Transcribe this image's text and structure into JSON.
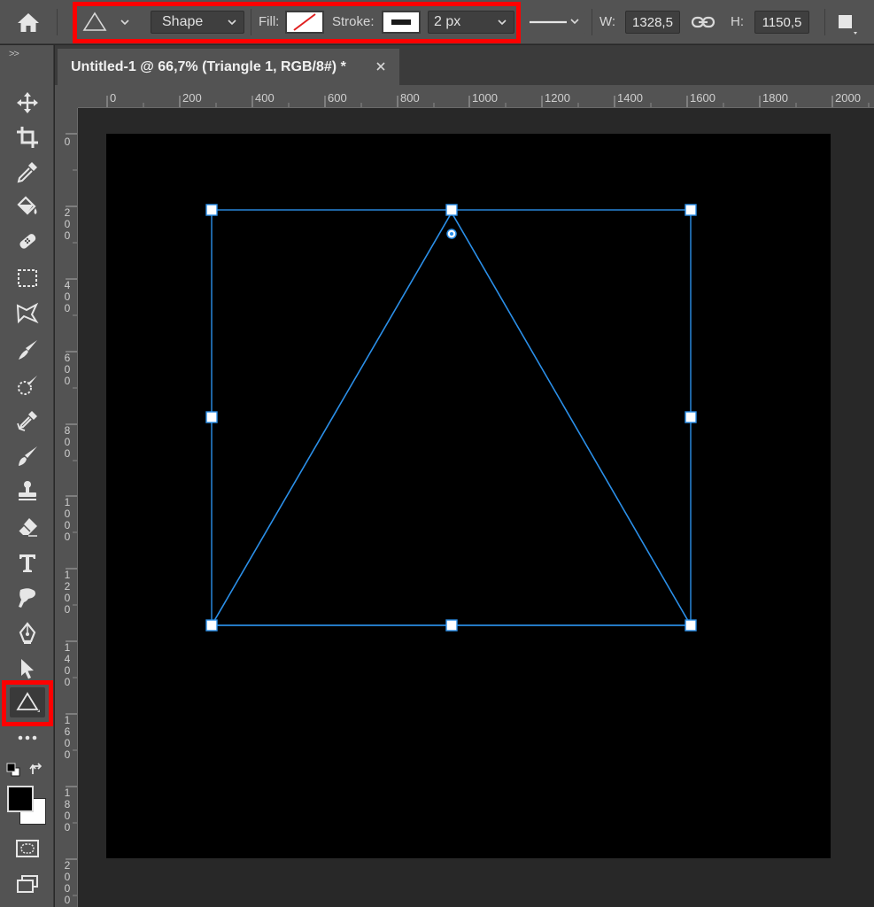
{
  "options_bar": {
    "mode_label": "Shape",
    "fill_label": "Fill:",
    "stroke_label": "Stroke:",
    "stroke_width": "2 px",
    "width_label": "W:",
    "width_value": "1328,5",
    "height_label": "H:",
    "height_value": "1150,5",
    "highlight_color": "#ff0000"
  },
  "document_tab": {
    "title": "Untitled-1 @ 66,7% (Triangle 1, RGB/8#) *",
    "close_glyph": "×"
  },
  "toolbar": {
    "collapse_glyph": ">>",
    "tools": [
      "move-icon",
      "crop-icon",
      "eyedropper-icon",
      "paint-bucket-icon",
      "spot-healing-icon",
      "rectangular-marquee-icon",
      "polygonal-lasso-icon",
      "smudge-icon",
      "quick-selection-icon",
      "color-sampler-icon",
      "brush-icon",
      "clone-stamp-icon",
      "eraser-icon",
      "type-icon",
      "finger-painting-icon",
      "pen-icon",
      "path-selection-icon",
      "triangle-tool-icon",
      "more-tools-icon"
    ],
    "active_tool": "triangle-tool-icon",
    "foreground_color": "#000000",
    "background_color": "#ffffff"
  },
  "rulers": {
    "horizontal": [
      "0",
      "200",
      "400",
      "600",
      "800",
      "1000",
      "1200",
      "1400",
      "1600",
      "1800",
      "2000"
    ],
    "vertical": [
      "0",
      "200",
      "400",
      "600",
      "800",
      "1000",
      "1200",
      "1400",
      "1600",
      "1800",
      "2000"
    ]
  },
  "canvas": {
    "background": "#000000",
    "selection_color": "#2b8fe8"
  }
}
